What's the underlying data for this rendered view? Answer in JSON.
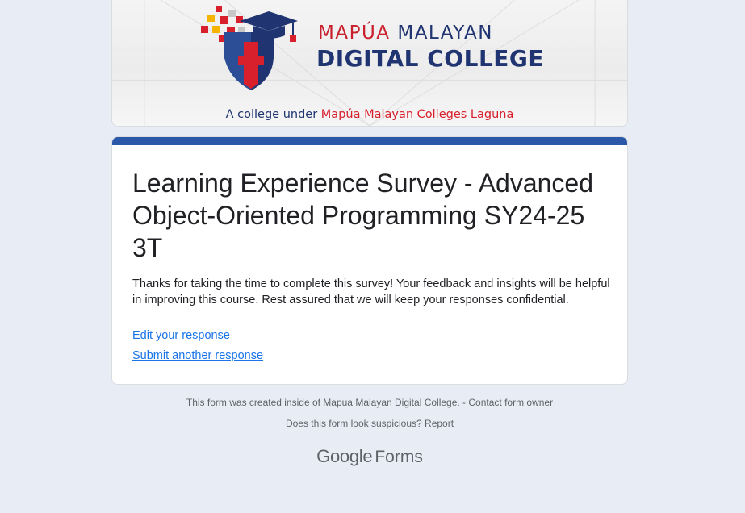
{
  "banner": {
    "brand_line1_red": "MAPÚA",
    "brand_line1_navy": "MALAYAN",
    "brand_line2": "DIGITAL COLLEGE",
    "tagline_prefix": "A college under",
    "tagline_highlight": "Mapúa Malayan Colleges Laguna",
    "colors": {
      "navy": "#1f3470",
      "red": "#c8202c"
    }
  },
  "form": {
    "title": "Learning Experience Survey - Advanced Object-Oriented Programming SY24-25 3T",
    "confirmation_message": "Thanks for taking the time to complete this survey! Your feedback and insights will be helpful in improving this course. Rest assured that we will keep your responses confidential.",
    "edit_link": "Edit your response",
    "submit_another_link": "Submit another response",
    "accent_color": "#2b58a8"
  },
  "footer": {
    "created_text": "This form was created inside of Mapua Malayan Digital College. -",
    "contact_link": "Contact form owner",
    "suspicious_text": "Does this form look suspicious?",
    "report_link": "Report",
    "brand_google": "Google",
    "brand_forms": "Forms"
  }
}
